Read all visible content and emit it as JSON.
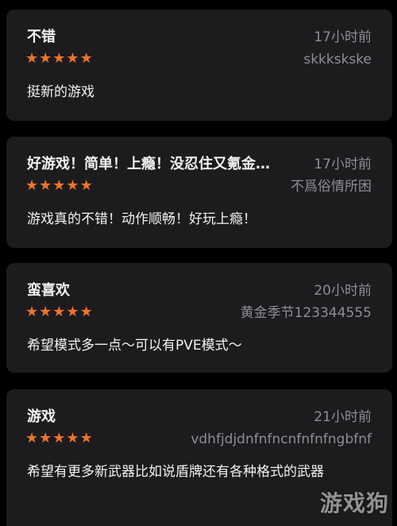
{
  "reviews": [
    {
      "title": "不错",
      "time": "17小时前",
      "rating": 5,
      "author": "skkkskske",
      "body": "挺新的游戏"
    },
    {
      "title": "好游戏！简单！上瘾！没忍住又氪金…",
      "time": "17小时前",
      "rating": 5,
      "author": "不爲俗情所困",
      "body": "游戏真的不错！动作顺畅！好玩上瘾！"
    },
    {
      "title": "蛮喜欢",
      "time": "20小时前",
      "rating": 5,
      "author": "黄金季节123344555",
      "body": "希望模式多一点～可以有PVE模式～"
    },
    {
      "title": "游戏",
      "time": "21小时前",
      "rating": 5,
      "author": "vdhfjdjdnfnfncnfnfnfngbfnf",
      "body": "希望有更多新武器比如说盾牌还有各种格式的武器"
    }
  ],
  "star_glyph": "★",
  "star_color": "#f0742a",
  "watermark": "游戏狗"
}
